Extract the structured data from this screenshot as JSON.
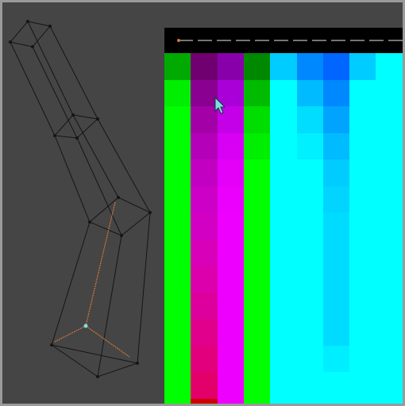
{
  "viewport": {
    "background": "#454545",
    "frame_color": "#9a9a9a",
    "mesh_stroke": "#151515",
    "bone_color": "#d2783c",
    "joint_color": "#7fe0e0"
  },
  "weight_panel": {
    "background": "#000000",
    "strip_line_color": "#9c9c9c",
    "strip_marker_color": "#d2783c",
    "columns": [
      {
        "name": "col-1",
        "rows": [
          "#00aa00",
          "#00ee00",
          "#00ff00",
          "#00ff00",
          "#00ff00",
          "#00ff00",
          "#00ff00",
          "#00ff00",
          "#00ff00",
          "#00ff00",
          "#00ff00",
          "#00ff00",
          "#00ff00",
          "#00ff00"
        ]
      },
      {
        "name": "col-2",
        "rows": [
          "#700070",
          "#8a0090",
          "#a400a8",
          "#b400b8",
          "#c200c2",
          "#cc00c6",
          "#d200c2",
          "#d800b8",
          "#dc00ac",
          "#de009c",
          "#e0008c",
          "#e2007c",
          "#e4006a",
          "#cc0000"
        ]
      },
      {
        "name": "col-3",
        "rows": [
          "#8800aa",
          "#aa00d8",
          "#c400e8",
          "#d800f4",
          "#e400f8",
          "#ea00fc",
          "#ee00ff",
          "#ee00ff",
          "#ee00ff",
          "#ee00ff",
          "#ee00ff",
          "#ee00ff",
          "#ee00ff",
          "#ee00ff"
        ]
      },
      {
        "name": "col-4",
        "rows": [
          "#008800",
          "#00bb00",
          "#00dd00",
          "#00ee00",
          "#00ff00",
          "#00ff00",
          "#00ff00",
          "#00ff00",
          "#00ff00",
          "#00ff00",
          "#00ff00",
          "#00ff00",
          "#00ff00",
          "#00ff00"
        ]
      },
      {
        "name": "col-5",
        "rows": [
          "#00ccff",
          "#00ffff",
          "#00ffff",
          "#00ffff",
          "#00ffff",
          "#00ffff",
          "#00ffff",
          "#00ffff",
          "#00ffff",
          "#00ffff",
          "#00ffff",
          "#00ffff",
          "#00ffff",
          "#00ffff"
        ]
      },
      {
        "name": "col-6",
        "rows": [
          "#0088ff",
          "#00bbff",
          "#00ddff",
          "#00f0ff",
          "#00ffff",
          "#00ffff",
          "#00ffff",
          "#00ffff",
          "#00ffff",
          "#00ffff",
          "#00ffff",
          "#00ffff",
          "#00ffff",
          "#00ffff"
        ]
      },
      {
        "name": "col-7",
        "rows": [
          "#0066ff",
          "#0088ff",
          "#00a4ff",
          "#00bbff",
          "#00ccff",
          "#00d4ff",
          "#00dcff",
          "#00dcff",
          "#00dcff",
          "#00dcff",
          "#00dcff",
          "#00eeff",
          "#00ffff",
          "#00ffff"
        ]
      },
      {
        "name": "col-8",
        "rows": [
          "#00ccff",
          "#00ffff",
          "#00ffff",
          "#00ffff",
          "#00ffff",
          "#00ffff",
          "#00ffff",
          "#00ffff",
          "#00ffff",
          "#00ffff",
          "#00ffff",
          "#00ffff",
          "#00ffff",
          "#00ffff"
        ]
      },
      {
        "name": "col-9",
        "rows": [
          "#00ffff",
          "#00ffff",
          "#00ffff",
          "#00ffff",
          "#00ffff",
          "#00ffff",
          "#00ffff",
          "#00ffff",
          "#00ffff",
          "#00ffff",
          "#00ffff",
          "#00ffff",
          "#00ffff",
          "#00ffff"
        ]
      }
    ]
  },
  "cursor": {
    "icon": "arrow-cursor-icon",
    "color": "#7fe0e0"
  }
}
